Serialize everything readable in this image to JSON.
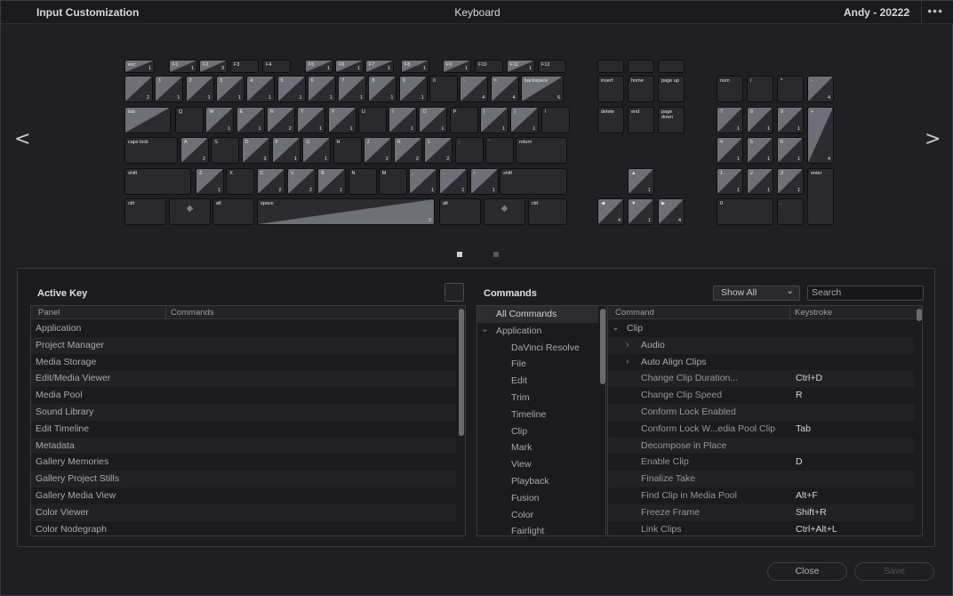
{
  "titlebar": {
    "title": "Input Customization",
    "center": "Keyboard",
    "user": "Andy - 20222",
    "chevron": "⌄",
    "menu": "•••"
  },
  "nav": {
    "prev": "<",
    "next": ">"
  },
  "keyboard": {
    "rows": [
      [
        [
          "esc",
          "1",
          "a"
        ],
        [
          "F1",
          "1",
          "a"
        ],
        [
          "F2",
          "3",
          "a"
        ],
        [
          "F3",
          "",
          ""
        ],
        [
          "F4",
          "",
          ""
        ],
        [
          "F5",
          "1",
          "a"
        ],
        [
          "F6",
          "1",
          "a"
        ],
        [
          "F7",
          "1",
          "a"
        ],
        [
          "F8",
          "1",
          "a"
        ],
        [
          "F9",
          "1",
          "a"
        ],
        [
          "F10",
          "",
          ""
        ],
        [
          "F11",
          "1",
          "a"
        ],
        [
          "F12",
          "",
          ""
        ]
      ],
      [
        [
          "`",
          "2",
          "a"
        ],
        [
          "1",
          "1",
          "a"
        ],
        [
          "2",
          "1",
          "a"
        ],
        [
          "3",
          "1",
          "a"
        ],
        [
          "4",
          "1",
          "a"
        ],
        [
          "5",
          "1",
          "a"
        ],
        [
          "6",
          "1",
          "a"
        ],
        [
          "7",
          "1",
          "a"
        ],
        [
          "8",
          "1",
          "a"
        ],
        [
          "9",
          "1",
          "a"
        ],
        [
          "0",
          "",
          ""
        ],
        [
          "-",
          "4",
          "a"
        ],
        [
          "=",
          "4",
          "a"
        ],
        [
          "backspace",
          "6",
          "a"
        ]
      ],
      [
        [
          "tab",
          "",
          "a"
        ],
        [
          "Q",
          "",
          ""
        ],
        [
          "W",
          "1",
          "a"
        ],
        [
          "E",
          "1",
          "a"
        ],
        [
          "R",
          "2",
          "a"
        ],
        [
          "T",
          "1",
          "a"
        ],
        [
          "Y",
          "1",
          "a"
        ],
        [
          "U",
          "",
          ""
        ],
        [
          "I",
          "1",
          "a"
        ],
        [
          "O",
          "1",
          "a"
        ],
        [
          "P",
          "",
          ""
        ],
        [
          "[",
          "1",
          "a"
        ],
        [
          "]",
          "1",
          "a"
        ],
        [
          "\\",
          "",
          ""
        ]
      ],
      [
        [
          "caps lock",
          "",
          ""
        ],
        [
          "A",
          "2",
          "a"
        ],
        [
          "S",
          "",
          ""
        ],
        [
          "D",
          "3",
          "a"
        ],
        [
          "F",
          "1",
          "a"
        ],
        [
          "G",
          "1",
          "a"
        ],
        [
          "H",
          "",
          ""
        ],
        [
          "J",
          "2",
          "a"
        ],
        [
          "K",
          "2",
          "a"
        ],
        [
          "L",
          "2",
          "a"
        ],
        [
          ";",
          "",
          ""
        ],
        [
          "'",
          "",
          ""
        ],
        [
          "return",
          "",
          ""
        ]
      ],
      [
        [
          "shift",
          "",
          ""
        ],
        [
          "Z",
          "1",
          "a"
        ],
        [
          "X",
          "",
          ""
        ],
        [
          "C",
          "2",
          "a"
        ],
        [
          "V",
          "2",
          "a"
        ],
        [
          "B",
          "1",
          "a"
        ],
        [
          "N",
          "",
          ""
        ],
        [
          "M",
          "",
          ""
        ],
        [
          ",",
          "1",
          "a"
        ],
        [
          ".",
          "1",
          "a"
        ],
        [
          "/",
          "1",
          "a"
        ],
        [
          "shift",
          "",
          ""
        ]
      ],
      [
        [
          "ctrl",
          "",
          ""
        ],
        [
          "◆",
          "",
          ""
        ],
        [
          "alt",
          "",
          ""
        ],
        [
          "space",
          "2",
          "a"
        ],
        [
          "alt",
          "",
          ""
        ],
        [
          "◆",
          "",
          ""
        ],
        [
          "ctrl",
          "",
          ""
        ]
      ]
    ],
    "nav_keys": [
      [
        "",
        "",
        ""
      ],
      [
        "",
        "",
        ""
      ],
      [
        "",
        "",
        ""
      ],
      [
        "insert",
        "",
        ""
      ],
      [
        "home",
        "",
        ""
      ],
      [
        "page up",
        "",
        ""
      ],
      [
        "delete",
        "",
        ""
      ],
      [
        "end",
        "",
        ""
      ],
      [
        "page\ndown",
        "",
        ""
      ],
      [
        "▲",
        "1",
        "a"
      ],
      [
        "◀",
        "4",
        "a"
      ],
      [
        "▼",
        "1",
        "a"
      ],
      [
        "▶",
        "4",
        "a"
      ]
    ],
    "numpad": [
      [
        "num",
        "",
        ""
      ],
      [
        "/",
        "",
        ""
      ],
      [
        "*",
        "",
        ""
      ],
      [
        "-",
        "4",
        "a"
      ],
      [
        "7",
        "1",
        "a"
      ],
      [
        "8",
        "1",
        "a"
      ],
      [
        "9",
        "1",
        "a"
      ],
      [
        "+",
        "4",
        "a"
      ],
      [
        "4",
        "1",
        "a"
      ],
      [
        "5",
        "1",
        "a"
      ],
      [
        "6",
        "1",
        "a"
      ],
      [
        "1",
        "1",
        "a"
      ],
      [
        "2",
        "1",
        "a"
      ],
      [
        "3",
        "1",
        "a"
      ],
      [
        "enter",
        "",
        ""
      ],
      [
        "0",
        "",
        ""
      ],
      [
        ".",
        "",
        ""
      ]
    ]
  },
  "active_key": {
    "title": "Active Key",
    "col_panel": "Panel",
    "col_commands": "Commands",
    "rows": [
      "Application",
      "Project Manager",
      "Media Storage",
      "Edit/Media Viewer",
      "Media Pool",
      "Sound Library",
      "Edit Timeline",
      "Metadata",
      "Gallery Memories",
      "Gallery Project Stills",
      "Gallery Media View",
      "Color Viewer",
      "Color Nodegraph"
    ]
  },
  "commands": {
    "title": "Commands",
    "dropdown": "Show All",
    "dropdown_arrow": "⌄",
    "search_placeholder": "Search",
    "tree": [
      [
        "All Commands",
        0,
        ""
      ],
      [
        "Application",
        0,
        "⌄"
      ],
      [
        "DaVinci Resolve",
        1,
        ""
      ],
      [
        "File",
        1,
        ""
      ],
      [
        "Edit",
        1,
        ""
      ],
      [
        "Trim",
        1,
        ""
      ],
      [
        "Timeline",
        1,
        ""
      ],
      [
        "Clip",
        1,
        ""
      ],
      [
        "Mark",
        1,
        ""
      ],
      [
        "View",
        1,
        ""
      ],
      [
        "Playback",
        1,
        ""
      ],
      [
        "Fusion",
        1,
        ""
      ],
      [
        "Color",
        1,
        ""
      ],
      [
        "Fairlight",
        1,
        ""
      ]
    ],
    "col_command": "Command",
    "col_keystroke": "Keystroke",
    "rows": [
      [
        "Clip",
        "",
        "⌄",
        0
      ],
      [
        "Audio",
        "",
        "›",
        1
      ],
      [
        "Auto Align Clips",
        "",
        "›",
        1
      ],
      [
        "Change Clip Duration...",
        "Ctrl+D",
        "",
        2
      ],
      [
        "Change Clip Speed",
        "R",
        "",
        2
      ],
      [
        "Conform Lock Enabled",
        "",
        "",
        2
      ],
      [
        "Conform Lock W...edia Pool Clip",
        "Tab",
        "",
        2
      ],
      [
        "Decompose in Place",
        "",
        "",
        2
      ],
      [
        "Enable Clip",
        "D",
        "",
        2
      ],
      [
        "Finalize Take",
        "",
        "",
        2
      ],
      [
        "Find Clip in Media Pool",
        "Alt+F",
        "",
        2
      ],
      [
        "Freeze Frame",
        "Shift+R",
        "",
        2
      ],
      [
        "Link Clips",
        "Ctrl+Alt+L",
        "",
        2
      ]
    ]
  },
  "buttons": {
    "close": "Close",
    "save": "Save"
  }
}
